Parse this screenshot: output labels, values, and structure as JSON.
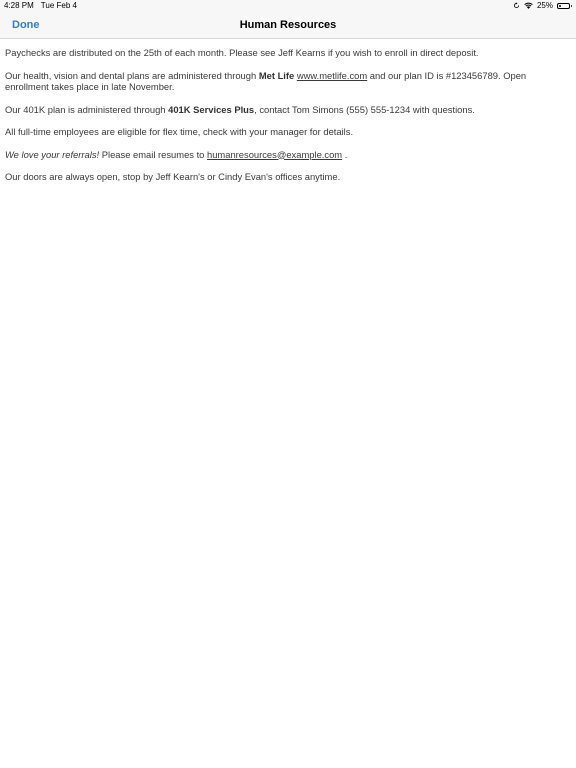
{
  "status_bar": {
    "time": "4:28 PM",
    "date": "Tue Feb 4",
    "battery_percent": "25%",
    "battery_level": 0.25,
    "icons": [
      "rotation-lock-icon",
      "wifi-icon",
      "battery-icon"
    ]
  },
  "nav": {
    "done_label": "Done",
    "title": "Human Resources",
    "accent_color": "#2f7fd8"
  },
  "content": {
    "p1": "Paychecks are distributed on the 25th of each month. Please see Jeff Kearns if you wish to enroll in direct deposit.",
    "p2": {
      "before": "Our health, vision and dental plans are administered through ",
      "provider": "Met Life",
      "space": " ",
      "link": "www.metlife.com",
      "after": " and our plan ID is #123456789. Open enrollment takes place in late November."
    },
    "p3": {
      "before": "Our 401K plan is administered through ",
      "provider": "401K Services Plus",
      "after": ", contact Tom Simons (555) 555-1234 with questions."
    },
    "p4": "All full-time employees are eligible for flex time, check with your manager for details.",
    "p5": {
      "emphasis": "We love your referrals!",
      "before": " Please email resumes to ",
      "email": "humanresources@example.com",
      "after": " ."
    },
    "p6": "Our doors are always open, stop by Jeff Kearn's or Cindy Evan's offices anytime."
  }
}
